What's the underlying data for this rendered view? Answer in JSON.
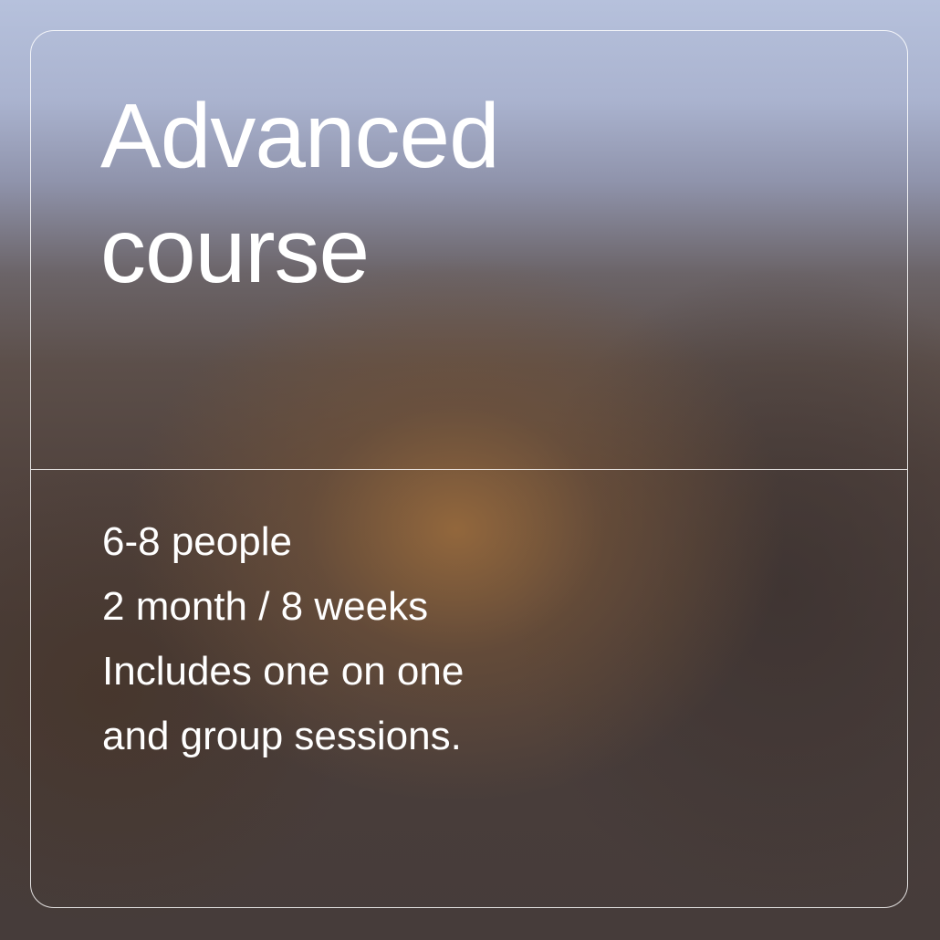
{
  "card": {
    "title_lines": [
      "Advanced",
      "course"
    ],
    "details": [
      "6-8 people",
      "2 month / 8 weeks",
      "Includes one on one",
      "and group sessions."
    ]
  },
  "colors": {
    "text": "#ffffff",
    "border": "#ffffff",
    "background_top": "#b6c1dc",
    "background_warm_glow": "#96693c",
    "background_bottom": "#463c3a"
  }
}
